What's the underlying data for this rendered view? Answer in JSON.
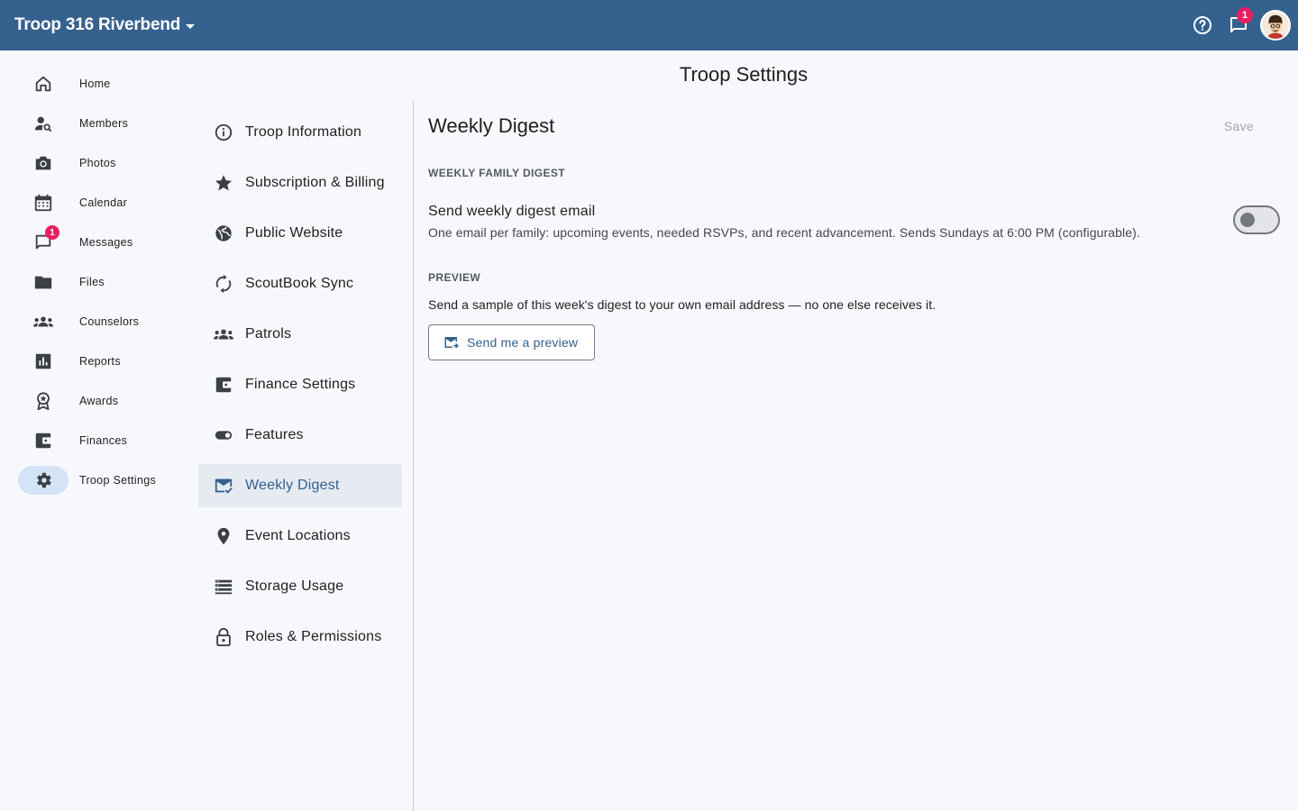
{
  "app": {
    "troop_name": "Troop 316 Riverbend",
    "messages_badge": "1"
  },
  "rail": {
    "items": [
      {
        "label": "Home",
        "icon": "home-icon"
      },
      {
        "label": "Members",
        "icon": "person-search-icon"
      },
      {
        "label": "Photos",
        "icon": "camera-icon"
      },
      {
        "label": "Calendar",
        "icon": "calendar-icon"
      },
      {
        "label": "Messages",
        "icon": "chat-icon",
        "badge": "1"
      },
      {
        "label": "Files",
        "icon": "folder-icon"
      },
      {
        "label": "Counselors",
        "icon": "groups-icon"
      },
      {
        "label": "Reports",
        "icon": "bar-chart-icon"
      },
      {
        "label": "Awards",
        "icon": "award-icon"
      },
      {
        "label": "Finances",
        "icon": "wallet-icon"
      },
      {
        "label": "Troop Settings",
        "icon": "gear-icon",
        "active": true
      }
    ]
  },
  "page": {
    "title": "Troop Settings"
  },
  "settings_menu": {
    "items": [
      {
        "label": "Troop Information",
        "icon": "info-icon"
      },
      {
        "label": "Subscription & Billing",
        "icon": "star-icon"
      },
      {
        "label": "Public Website",
        "icon": "globe-icon"
      },
      {
        "label": "ScoutBook Sync",
        "icon": "sync-icon"
      },
      {
        "label": "Patrols",
        "icon": "groups-icon"
      },
      {
        "label": "Finance Settings",
        "icon": "wallet-icon"
      },
      {
        "label": "Features",
        "icon": "toggle-icon"
      },
      {
        "label": "Weekly Digest",
        "icon": "mark-email-read-icon",
        "active": true
      },
      {
        "label": "Event Locations",
        "icon": "location-pin-icon"
      },
      {
        "label": "Storage Usage",
        "icon": "storage-icon"
      },
      {
        "label": "Roles & Permissions",
        "icon": "lock-icon"
      }
    ]
  },
  "content": {
    "title": "Weekly Digest",
    "save_label": "Save",
    "section_digest": "WEEKLY FAMILY DIGEST",
    "setting_title": "Send weekly digest email",
    "setting_desc": "One email per family: upcoming events, needed RSVPs, and recent advancement. Sends Sundays at 6:00 PM (configurable).",
    "toggle_on": false,
    "section_preview": "PREVIEW",
    "preview_desc": "Send a sample of this week's digest to your own email address — no one else receives it.",
    "preview_button": "Send me a preview"
  },
  "colors": {
    "topbar": "#35618f",
    "accent": "#35618f",
    "badge": "#e91e63",
    "active_rail": "#d5e3f7",
    "active_menu": "#e6eaf1"
  }
}
